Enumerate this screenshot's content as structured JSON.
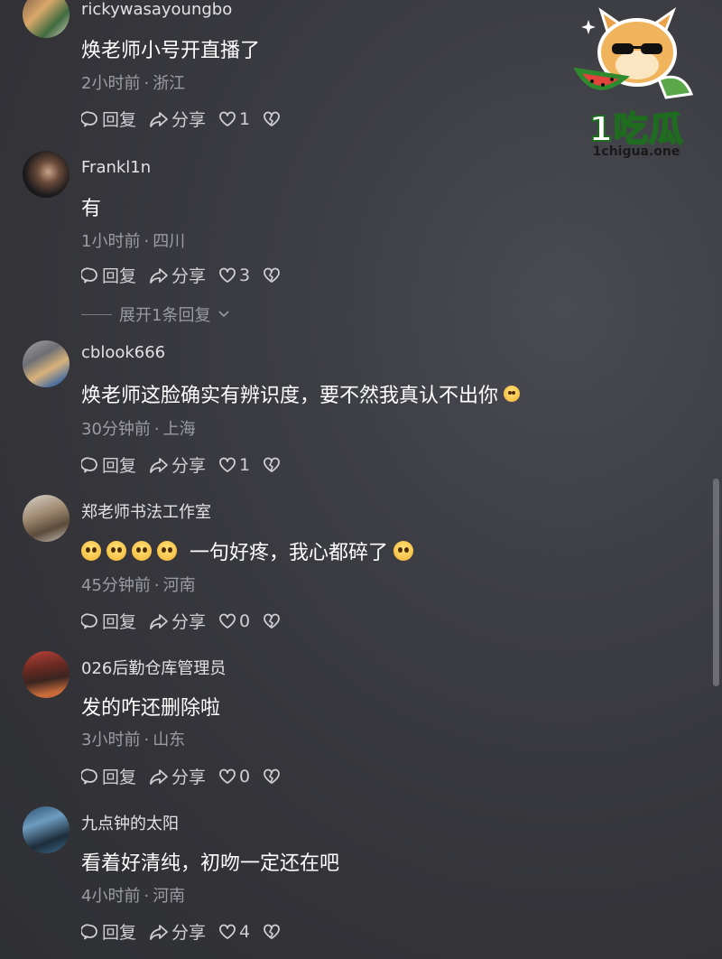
{
  "logo": {
    "name": "1吃瓜",
    "url": "1chigua.one"
  },
  "actions": {
    "reply": "回复",
    "share": "分享"
  },
  "comments": [
    {
      "username": "rickywasayoungbo",
      "text": "焕老师小号开直播了",
      "time": "2小时前",
      "location": "浙江",
      "likes": "1"
    },
    {
      "username": "Frankl1n",
      "text": "有",
      "time": "1小时前",
      "location": "四川",
      "likes": "3",
      "expand": "展开1条回复"
    },
    {
      "username": "cblook666",
      "text": "焕老师这脸确实有辨识度，要不然我真认不出你",
      "time": "30分钟前",
      "location": "上海",
      "likes": "1"
    },
    {
      "username": "郑老师书法工作室",
      "text": "一句好疼，我心都碎了",
      "time": "45分钟前",
      "location": "河南",
      "likes": "0"
    },
    {
      "username": "026后勤仓库管理员",
      "text": "发的咋还删除啦",
      "time": "3小时前",
      "location": "山东",
      "likes": "0"
    },
    {
      "username": "九点钟的太阳",
      "text": "看着好清纯，初吻一定还在吧",
      "time": "4小时前",
      "location": "河南",
      "likes": "4"
    }
  ],
  "colors": {
    "background": "#3a3b40",
    "text": "#ffffff",
    "meta": "#9c9ca4",
    "logo_green": "#1f6b1f"
  }
}
